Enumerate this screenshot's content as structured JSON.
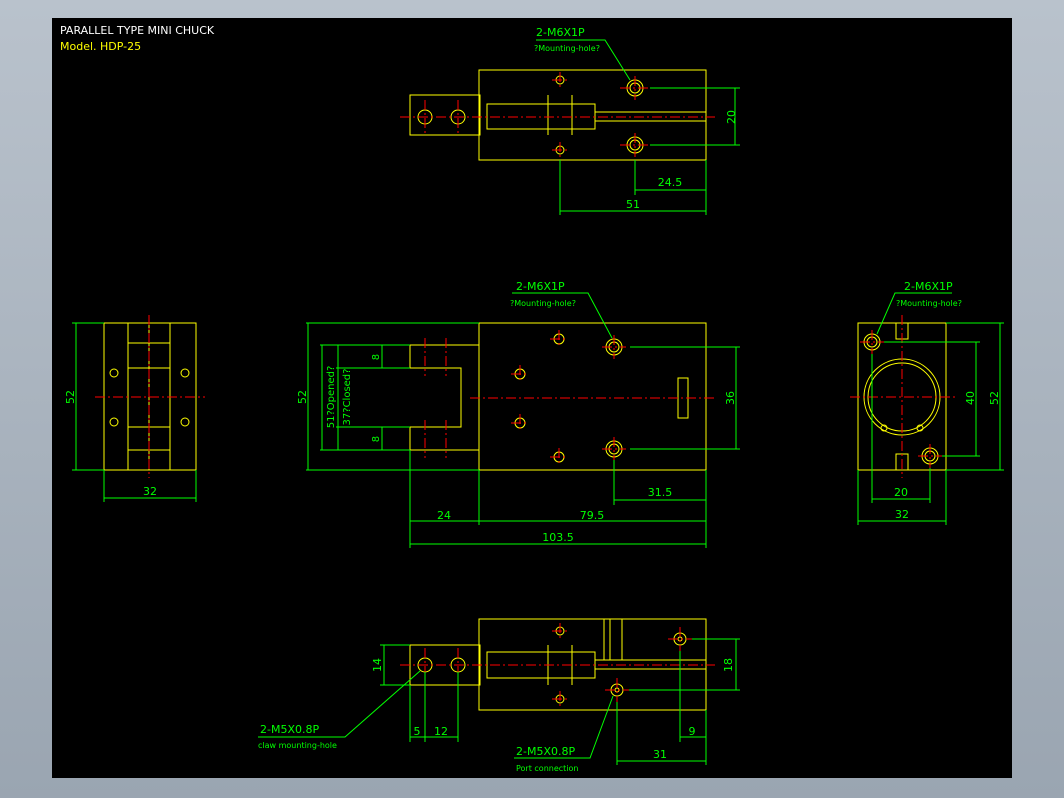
{
  "title": {
    "line1": "PARALLEL TYPE MINI CHUCK",
    "line2": "Model.  HDP-25"
  },
  "colors": {
    "background": "#000000",
    "outline": "#ffff00",
    "dimension": "#00ff00",
    "centerline": "#ff0000",
    "text": "#ffffff"
  },
  "top_view": {
    "callout": "2-M6X1P",
    "callout_note": "?Mounting-hole?",
    "dim_20": "20",
    "dim_24_5": "24.5",
    "dim_51": "51"
  },
  "front_view": {
    "callout": "2-M6X1P",
    "callout_note": "?Mounting-hole?",
    "dim_52": "52",
    "dim_opened": "51?Opened?",
    "dim_closed": "37?Closed?",
    "dim_8a": "8",
    "dim_8b": "8",
    "dim_36": "36",
    "dim_31_5": "31.5",
    "dim_24": "24",
    "dim_79_5": "79.5",
    "dim_103_5": "103.5"
  },
  "left_view": {
    "dim_52": "52",
    "dim_32": "32"
  },
  "right_view": {
    "callout": "2-M6X1P",
    "callout_note": "?Mounting-hole?",
    "dim_40": "40",
    "dim_52": "52",
    "dim_20": "20",
    "dim_32": "32"
  },
  "bottom_view": {
    "claw_callout": "2-M5X0.8P",
    "claw_note": "claw mounting-hole",
    "port_callout": "2-M5X0.8P",
    "port_note": "Port connection",
    "dim_14": "14",
    "dim_18": "18",
    "dim_5": "5",
    "dim_12": "12",
    "dim_9": "9",
    "dim_31": "31"
  }
}
